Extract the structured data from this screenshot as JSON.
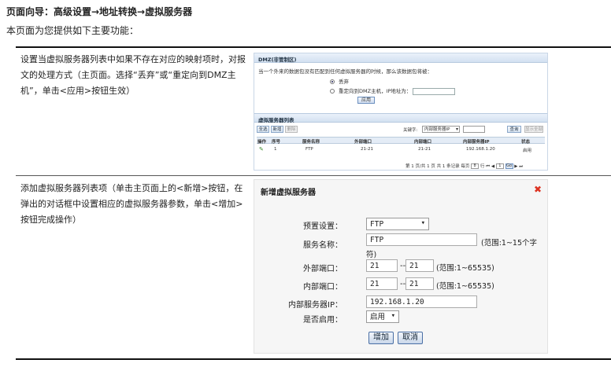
{
  "page": {
    "nav_title": "页面向导：高级设置→地址转换→虚拟服务器",
    "intro": "本页面为您提供如下主要功能："
  },
  "section1": {
    "desc": "设置当虚拟服务器列表中如果不存在对应的映射项时，对报文的处理方式（主页面。选择“丢弃”或“重定向到DMZ主机”，单击<应用>按钮生效）"
  },
  "section2": {
    "desc": "添加虚拟服务器列表项（单击主页面上的<新增>按钮，在弹出的对话框中设置相应的虚拟服务器参数，单击<增加>按钮完成操作）"
  },
  "panel1": {
    "dmz_title": "DMZ(非管制区)",
    "question": "当一个外来的数据包没有匹配到任何虚拟服务器的时候，那么该数据包将被：",
    "opt_drop": "丢弃",
    "opt_redirect": "重定向到DMZ主机，IP地址为：",
    "apply": "应用",
    "list_title": "虚拟服务器列表",
    "btn_all": "全选",
    "btn_new": "新增",
    "btn_delete": "删除",
    "search_label": "关键字:",
    "search_select": "内部服务器IP",
    "btn_query": "查询",
    "btn_show_all": "显示全部",
    "headers": [
      "操作",
      "序号",
      "服务名称",
      "外部端口",
      "内部端口",
      "内部服务器IP",
      "状态"
    ],
    "row": [
      "1",
      "FTP",
      "21-21",
      "21-21",
      "192.168.1.20",
      "启用"
    ],
    "pager_text": "第 1 页/共 1 页 共 1 条记录 每页",
    "per_page": "8",
    "pager_text2": "行",
    "page_num": "1",
    "go": "Go"
  },
  "dialog": {
    "title": "新增虚拟服务器",
    "preset_label": "预置设置：",
    "preset_value": "FTP",
    "name_label": "服务名称：",
    "name_value": "FTP",
    "name_hint": "(范围:1~15个字",
    "name_hint2": "符)",
    "ext_label": "外部端口：",
    "ext_from": "21",
    "ext_to": "21",
    "ext_hint": "(范围:1~65535)",
    "int_label": "内部端口：",
    "int_from": "21",
    "int_to": "21",
    "int_hint": "(范围:1~65535)",
    "ip_label": "内部服务器IP：",
    "ip_value": "192.168.1.20",
    "enable_label": "是否启用：",
    "enable_value": "启用",
    "dash": "--",
    "btn_add": "增加",
    "btn_cancel": "取消"
  },
  "colors": {
    "accent": "#4a6fa5",
    "header_bg": "#d3e1f1",
    "close": "#dd3322"
  }
}
